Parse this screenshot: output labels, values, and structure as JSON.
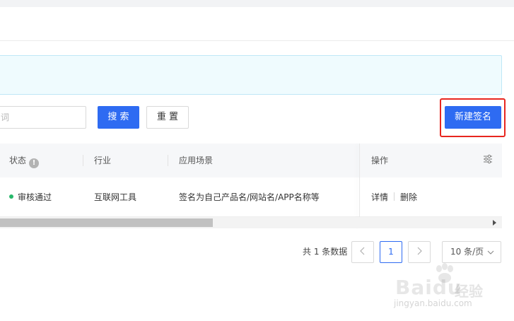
{
  "filters": {
    "keyword_placeholder": "词",
    "search_label": "搜 索",
    "reset_label": "重 置",
    "new_signature_label": "新建签名"
  },
  "table": {
    "columns": {
      "status": "状态",
      "industry": "行业",
      "scene": "应用场景",
      "action": "操作"
    },
    "rows": [
      {
        "status": "审核通过",
        "industry": "互联网工具",
        "scene": "签名为自己产品名/网站名/APP名称等",
        "actions": {
          "detail": "详情",
          "delete": "删除"
        }
      }
    ]
  },
  "pagination": {
    "total_text": "共 1 条数据",
    "current_page": "1",
    "page_size": "10 条/页"
  },
  "watermark": {
    "brand": "Baidu",
    "cn": "经验",
    "url": "jingyan.baidu.com"
  },
  "colors": {
    "primary": "#2e6bf2",
    "highlight": "#e8261f",
    "status_ok": "#27b86a",
    "notice_bg": "#effbfe"
  },
  "icons": {
    "status_info": "info-icon",
    "column_settings": "settings-icon",
    "prev": "chevron-left-icon",
    "next": "chevron-right-icon",
    "page_size_dropdown": "chevron-down-icon"
  }
}
